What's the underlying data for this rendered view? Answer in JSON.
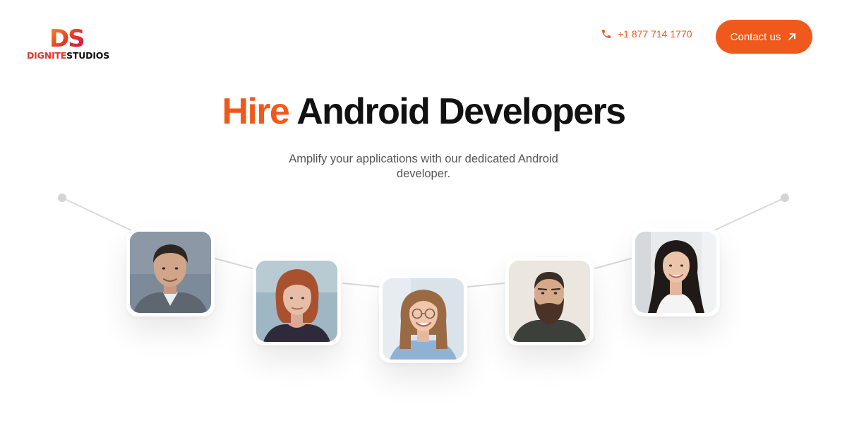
{
  "header": {
    "logo": {
      "mark": "DS",
      "text_a": "DIGNITE",
      "text_b": "STUDIOS",
      "colors": [
        "#f7931e",
        "#e8332b",
        "#c2185b"
      ]
    },
    "phone": {
      "icon": "phone-icon",
      "number": "+1 877 714 1770"
    },
    "contact_button": {
      "label": "Contact us",
      "icon": "arrow-up-right-icon"
    }
  },
  "hero": {
    "title_highlight": "Hire",
    "title_rest": "Android Developers",
    "subtitle": "Amplify your applications with our dedicated Android developer."
  },
  "developers": [
    {
      "portrait": "man-short-dark-hair",
      "background": "#7d8a9a"
    },
    {
      "portrait": "woman-red-bob",
      "background": "#9fb7c2"
    },
    {
      "portrait": "woman-glasses-smiling",
      "background": "#dbe3ea"
    },
    {
      "portrait": "man-bearded",
      "background": "#ebe6e0"
    },
    {
      "portrait": "woman-long-dark-hair",
      "background": "#e7e9ea"
    }
  ],
  "colors": {
    "accent": "#ef5a1c",
    "title": "#111111",
    "subtitle": "#555555",
    "path_line": "#d9d9d9"
  }
}
